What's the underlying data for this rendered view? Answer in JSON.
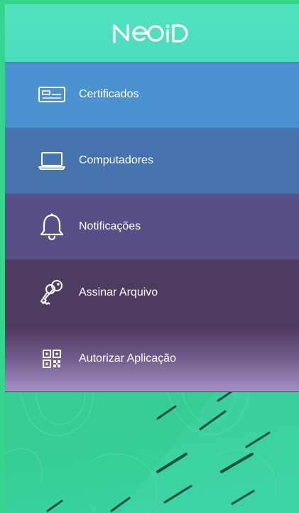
{
  "header": {
    "logo_text": "NEOID"
  },
  "menu": {
    "items": [
      {
        "label": "Certificados",
        "icon": "id-card-icon"
      },
      {
        "label": "Computadores",
        "icon": "laptop-icon"
      },
      {
        "label": "Notificações",
        "icon": "bell-icon"
      },
      {
        "label": "Assinar Arquivo",
        "icon": "keys-icon"
      },
      {
        "label": "Autorizar Aplicação",
        "icon": "qr-code-icon"
      }
    ]
  },
  "colors": {
    "header_bg": "#4fe0bf",
    "certificados_bg": "#4b93d0",
    "computadores_bg": "#4673ad",
    "notificacoes_bg": "#594f86",
    "assinar_bg": "#4d3c5f",
    "autorizar_bg": "#6d5889",
    "background": "#37cf94"
  }
}
